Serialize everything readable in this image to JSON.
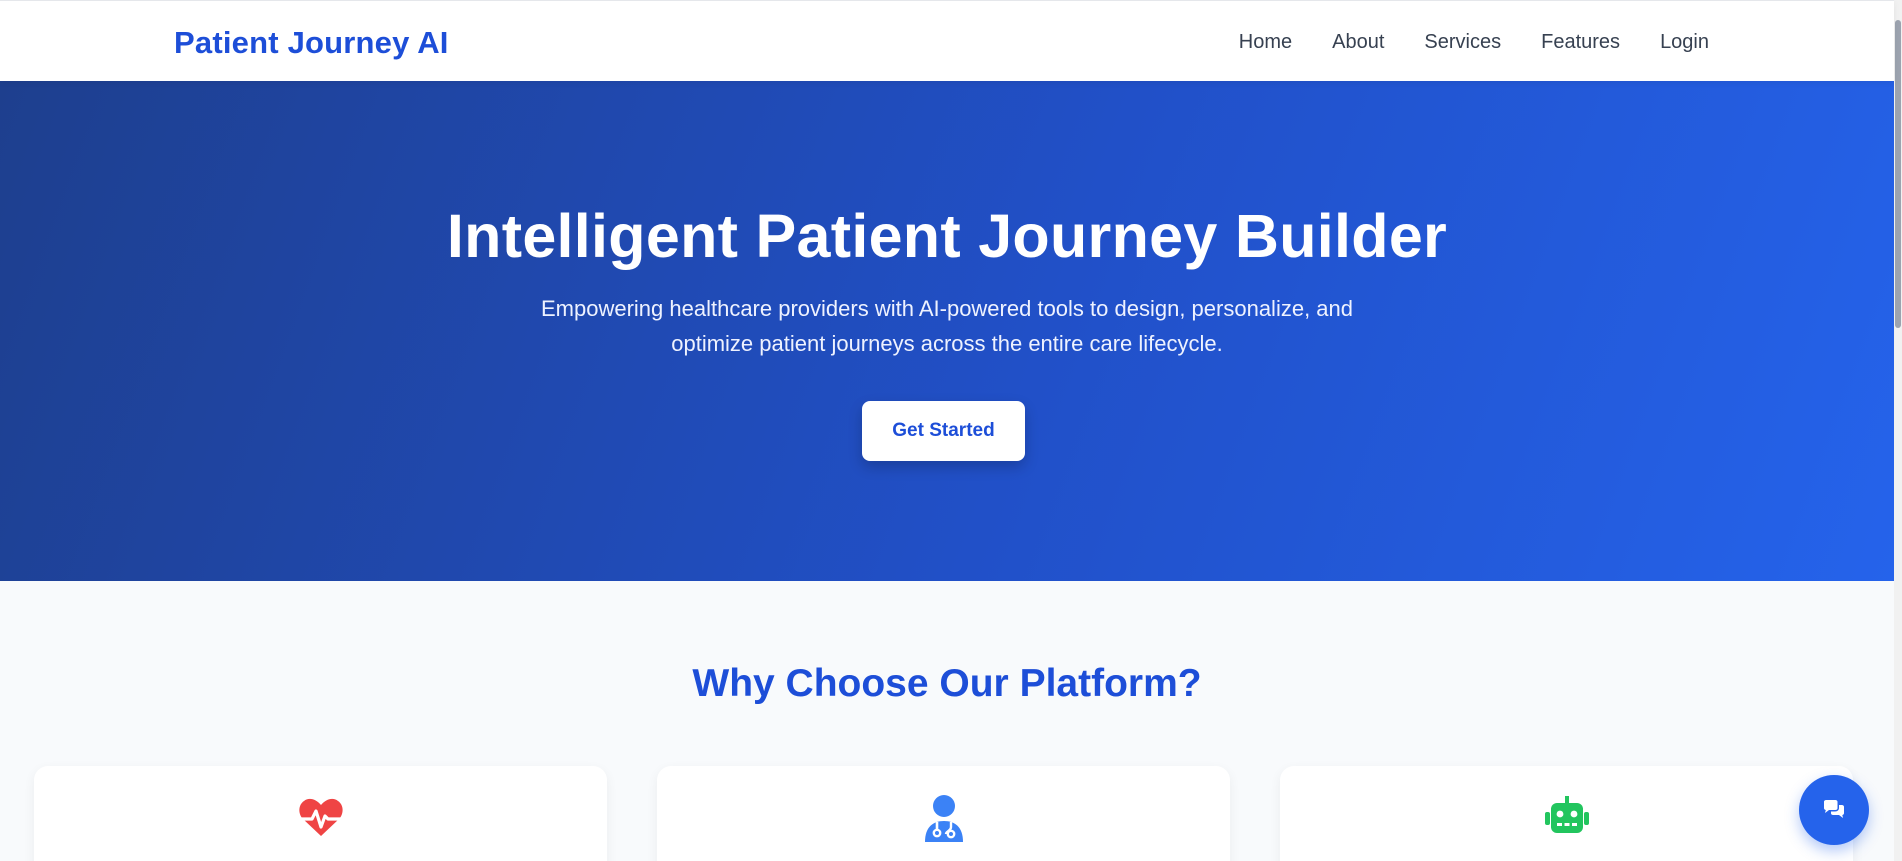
{
  "header": {
    "brand": "Patient Journey AI",
    "nav": [
      "Home",
      "About",
      "Services",
      "Features",
      "Login"
    ]
  },
  "hero": {
    "title": "Intelligent Patient Journey Builder",
    "subtitle": "Empowering healthcare providers with AI-powered tools to design, personalize, and optimize patient journeys across the entire care lifecycle.",
    "cta_label": "Get Started"
  },
  "features": {
    "title": "Why Choose Our Platform?",
    "cards": [
      {
        "icon": "heartbeat-icon",
        "color": "#ef4444"
      },
      {
        "icon": "doctor-icon",
        "color": "#3b82f6"
      },
      {
        "icon": "robot-icon",
        "color": "#22c55e"
      }
    ]
  },
  "chat": {
    "icon": "chat-icon"
  },
  "colors": {
    "brand": "#1d4ed8",
    "hero_start": "#1e3f8e",
    "hero_end": "#2563eb"
  }
}
